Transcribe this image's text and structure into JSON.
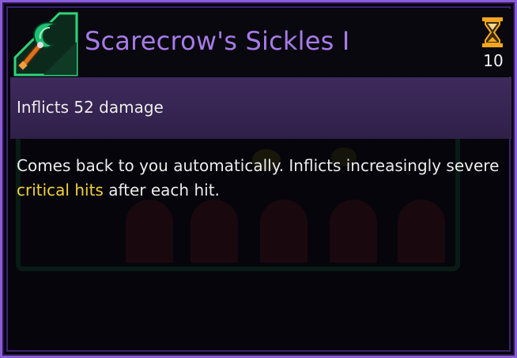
{
  "item": {
    "name": "Scarecrow's Sickles I",
    "icon": "green-sickle-icon",
    "cooldown_icon": "hourglass-icon",
    "cooldown_value": "10"
  },
  "stats": {
    "damage_line": "Inflicts 52 damage"
  },
  "description": {
    "part1": "Comes back to you automatically. Inflicts increasingly severe ",
    "highlight": "critical hits",
    "part2": " after each hit."
  },
  "colors": {
    "title": "#a77be8",
    "border": "#8a5bd6",
    "damage_band": "#3a2757",
    "highlight": "#f0d23a",
    "text": "#ececec"
  }
}
